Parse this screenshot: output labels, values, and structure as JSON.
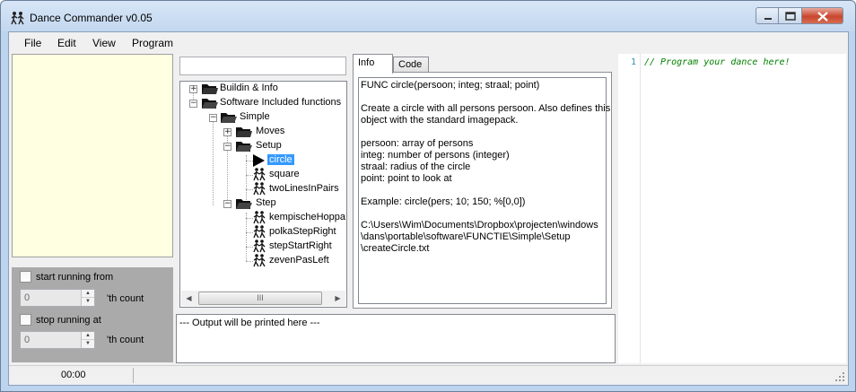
{
  "window": {
    "title": "Dance Commander v0.05",
    "close_color": "#c9462e"
  },
  "menu": {
    "items": [
      "File",
      "Edit",
      "View",
      "Program"
    ]
  },
  "run_controls": {
    "start_label": "start running from",
    "start_value": "0",
    "start_suffix": "'th count",
    "stop_label": "stop running at",
    "stop_value": "0",
    "stop_suffix": "'th count"
  },
  "search": {
    "value": ""
  },
  "tree": {
    "nodes": [
      {
        "label": "Buildin & Info",
        "expander": "+"
      },
      {
        "label": "Software Included functions",
        "expander": "−"
      },
      {
        "label": "Simple",
        "expander": "−"
      },
      {
        "label": "Moves",
        "expander": "+"
      },
      {
        "label": "Setup",
        "expander": "−"
      },
      {
        "label": "circle",
        "selected": true
      },
      {
        "label": "square"
      },
      {
        "label": "twoLinesInPairs"
      },
      {
        "label": "Step",
        "expander": "−"
      },
      {
        "label": "kempischeHoppa"
      },
      {
        "label": "polkaStepRight"
      },
      {
        "label": "stepStartRight"
      },
      {
        "label": "zevenPasLeft"
      }
    ],
    "scroll_grip": "III"
  },
  "tabs": {
    "info": "Info",
    "code": "Code",
    "active": "Info"
  },
  "info": {
    "lines": [
      "FUNC circle(persoon; integ; straal; point)",
      "",
      "Create a circle with all persons persoon. Also defines this",
      "object with the standard imagepack.",
      "",
      "persoon: array of persons",
      "integ: number of persons (integer)",
      "straal: radius of the circle",
      "point: point to look at",
      "",
      "Example: circle(pers; 10; 150; %[0,0])",
      "",
      "C:\\Users\\Wim\\Documents\\Dropbox\\projecten\\windows",
      "\\dans\\portable\\software\\FUNCTIE\\Simple\\Setup",
      "\\createCircle.txt"
    ]
  },
  "output": {
    "text": "--- Output will be printed here ---"
  },
  "editor": {
    "line_number": "1",
    "code": "// Program your dance here!",
    "comment_color": "#008000"
  },
  "status": {
    "time": "00:00"
  }
}
